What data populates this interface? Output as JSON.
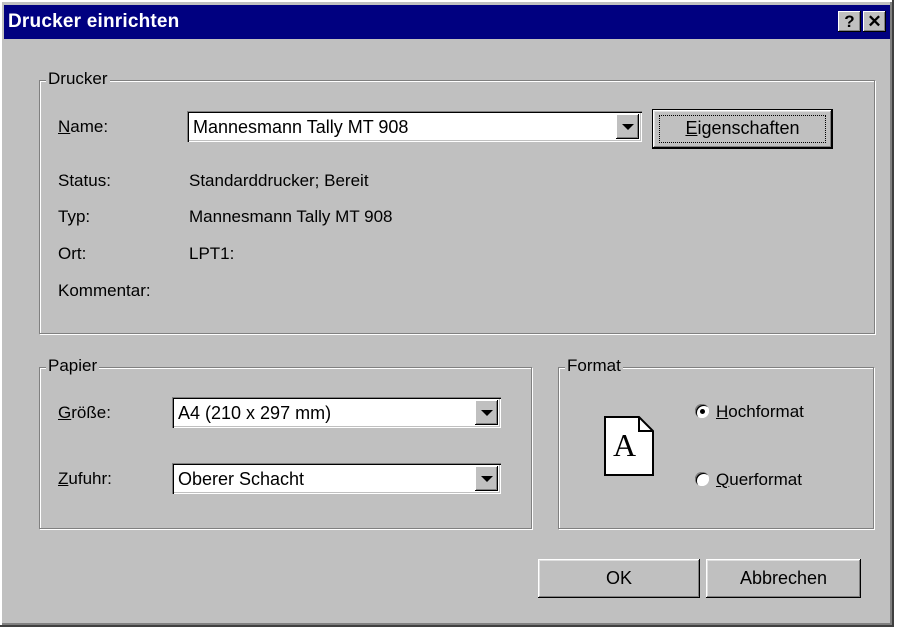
{
  "window": {
    "title": "Drucker einrichten",
    "help_button": "?",
    "close_button": "✕"
  },
  "printer": {
    "group_label": "Drucker",
    "name_label_accel": "N",
    "name_label_rest": "ame:",
    "name_value": "Mannesmann Tally MT 908",
    "properties_accel": "E",
    "properties_rest": "igenschaften",
    "status_label": "Status:",
    "status_value": "Standarddrucker; Bereit",
    "type_label": "Typ:",
    "type_value": "Mannesmann Tally MT 908",
    "location_label": "Ort:",
    "location_value": "LPT1:",
    "comment_label": "Kommentar:"
  },
  "paper": {
    "group_label": "Papier",
    "size_label_accel": "G",
    "size_label_rest": "röße:",
    "size_value": "A4 (210 x 297 mm)",
    "source_label_accel": "Z",
    "source_label_rest": "ufuhr:",
    "source_value": "Oberer Schacht"
  },
  "format": {
    "group_label": "Format",
    "icon_letter": "A",
    "portrait_accel": "H",
    "portrait_rest": "ochformat",
    "landscape_accel": "Q",
    "landscape_rest": "uerformat",
    "selected": "portrait"
  },
  "buttons": {
    "ok": "OK",
    "cancel": "Abbrechen"
  }
}
